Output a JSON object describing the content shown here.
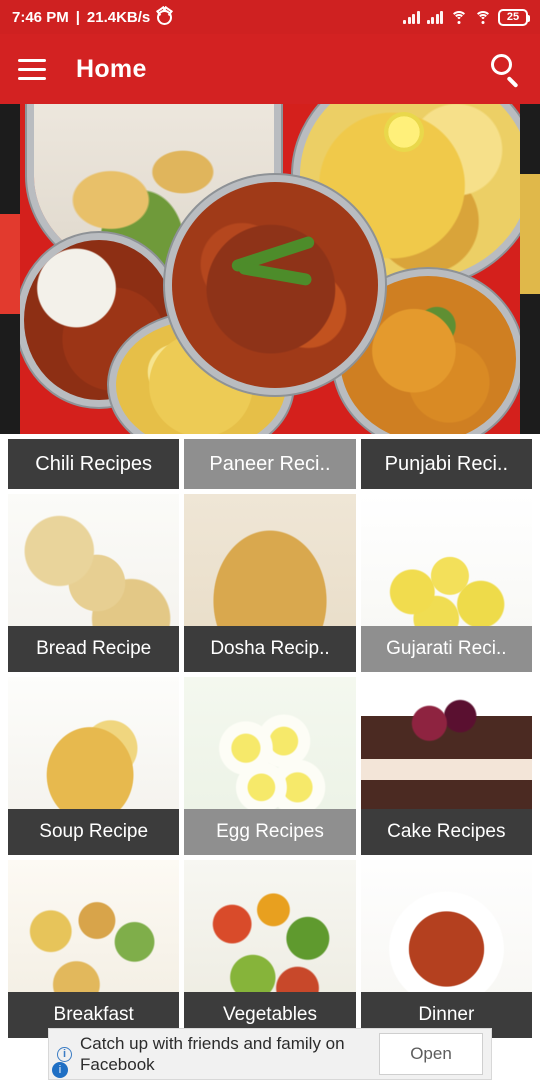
{
  "status_bar": {
    "time": "7:46 PM",
    "separator": "|",
    "network_speed": "21.4KB/s",
    "alarm_icon": "alarm-icon",
    "signal1_icon": "signal-bars-icon",
    "signal2_icon": "signal-bars-icon",
    "wifi_hotspot_icon": "wifi-hotspot-icon",
    "wifi_icon": "wifi-icon",
    "battery_level": "25",
    "background_color": "#cf2121"
  },
  "app_bar": {
    "menu_icon": "hamburger-menu-icon",
    "title": "Home",
    "search_icon": "search-icon",
    "background_color": "#d32222"
  },
  "banner": {
    "name": "featured-recipe-banner",
    "alt": "assorted indian curry dishes on red background"
  },
  "grid": {
    "rows": [
      [
        {
          "label": "Chili Recipes",
          "thumb": "t-chili",
          "caption_style": "dark"
        },
        {
          "label": "Paneer Reci..",
          "thumb": "t-paneer",
          "caption_style": "light"
        },
        {
          "label": "Punjabi Reci..",
          "thumb": "t-punjabi",
          "caption_style": "dark"
        }
      ],
      [
        {
          "label": "Bread Recipe",
          "thumb": "t-bread",
          "caption_style": "dark"
        },
        {
          "label": "Dosha Recip..",
          "thumb": "t-dosa",
          "caption_style": "dark"
        },
        {
          "label": "Gujarati Reci..",
          "thumb": "t-gujarati",
          "caption_style": "light"
        }
      ],
      [
        {
          "label": "Soup Recipe",
          "thumb": "t-soup",
          "caption_style": "dark"
        },
        {
          "label": "Egg Recipes",
          "thumb": "t-egg",
          "caption_style": "light"
        },
        {
          "label": "Cake Recipes",
          "thumb": "t-cake",
          "caption_style": "dark"
        }
      ],
      [
        {
          "label": "Breakfast",
          "thumb": "t-breakfast",
          "caption_style": "dark"
        },
        {
          "label": "Vegetables",
          "thumb": "t-veg",
          "caption_style": "dark"
        },
        {
          "label": "Dinner",
          "thumb": "t-dinner",
          "caption_style": "dark"
        }
      ]
    ]
  },
  "ad": {
    "info_icon": "ad-info-icon",
    "text": "Catch up with friends and family on Facebook",
    "button_label": "Open",
    "badge_icon": "ad-choices-icon",
    "badge_glyph": "i"
  }
}
